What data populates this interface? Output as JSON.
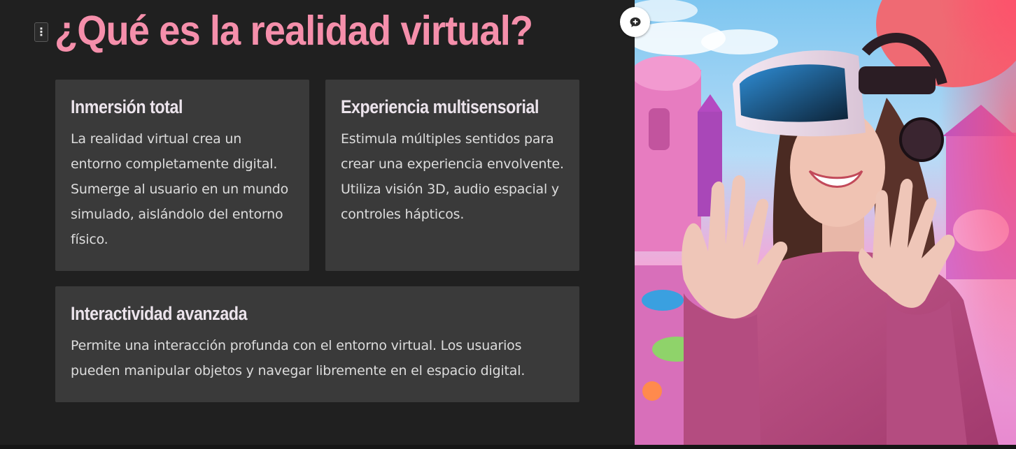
{
  "slide": {
    "title": "¿Qué es la realidad virtual?",
    "accent_color": "#f58fab",
    "cards": [
      {
        "heading": "Inmersión total",
        "body": "La realidad virtual crea un entorno completamente digital. Sumerge al usuario en un mundo simulado, aislándolo del entorno físico."
      },
      {
        "heading": "Experiencia multisensorial",
        "body": "Estimula múltiples sentidos para crear una experiencia envolvente. Utiliza visión 3D, audio espacial y controles hápticos."
      },
      {
        "heading": "Interactividad avanzada",
        "body": "Permite una interacción profunda con el entorno virtual. Los usuarios pueden manipular objetos y navegar libremente en el espacio digital."
      }
    ]
  },
  "toolbar": {
    "drag_handle_icon": "vertical-dots-icon",
    "drag_handle_glyph": "⋮",
    "comment_icon": "comment-plus-icon"
  },
  "hero_image": {
    "subject": "woman-wearing-vr-headset-illustration"
  }
}
